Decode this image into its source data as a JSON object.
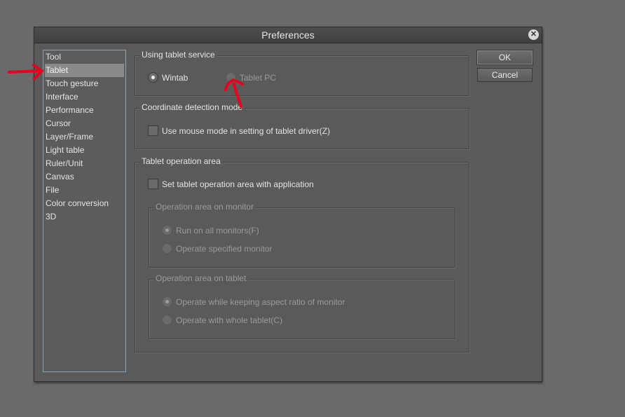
{
  "window": {
    "title": "Preferences"
  },
  "sidebar": {
    "items": [
      {
        "label": "Tool"
      },
      {
        "label": "Tablet"
      },
      {
        "label": "Touch gesture"
      },
      {
        "label": "Interface"
      },
      {
        "label": "Performance"
      },
      {
        "label": "Cursor"
      },
      {
        "label": "Layer/Frame"
      },
      {
        "label": "Light table"
      },
      {
        "label": "Ruler/Unit"
      },
      {
        "label": "Canvas"
      },
      {
        "label": "File"
      },
      {
        "label": "Color conversion"
      },
      {
        "label": "3D"
      }
    ],
    "selected": "Tablet"
  },
  "tablet_service": {
    "title": "Using tablet service",
    "options": {
      "wintab": {
        "label": "Wintab",
        "checked": true,
        "enabled": true
      },
      "tablet_pc": {
        "label": "Tablet PC",
        "checked": false,
        "enabled": false
      }
    }
  },
  "coordinate_mode": {
    "title": "Coordinate detection mode",
    "mouse_mode": {
      "label": "Use mouse mode in setting of tablet driver(Z)",
      "checked": false
    }
  },
  "operation_area": {
    "title": "Tablet operation area",
    "set_with_app": {
      "label": "Set tablet operation area with application",
      "checked": false
    },
    "monitor": {
      "title": "Operation area on monitor",
      "all_monitors": {
        "label": "Run on all monitors(F)",
        "checked": true,
        "enabled": false
      },
      "specified_monitor": {
        "label": "Operate specified monitor",
        "checked": false,
        "enabled": false
      }
    },
    "tablet": {
      "title": "Operation area on tablet",
      "keep_aspect": {
        "label": "Operate while keeping aspect ratio of monitor",
        "checked": true,
        "enabled": false
      },
      "whole_tablet": {
        "label": "Operate with whole tablet(C)",
        "checked": false,
        "enabled": false
      }
    }
  },
  "buttons": {
    "ok": "OK",
    "cancel": "Cancel",
    "close_symbol": "✕"
  },
  "colors": {
    "annotation": "#e8001c",
    "list_border": "#8aa3b3",
    "selection": "#8a8a8a"
  }
}
